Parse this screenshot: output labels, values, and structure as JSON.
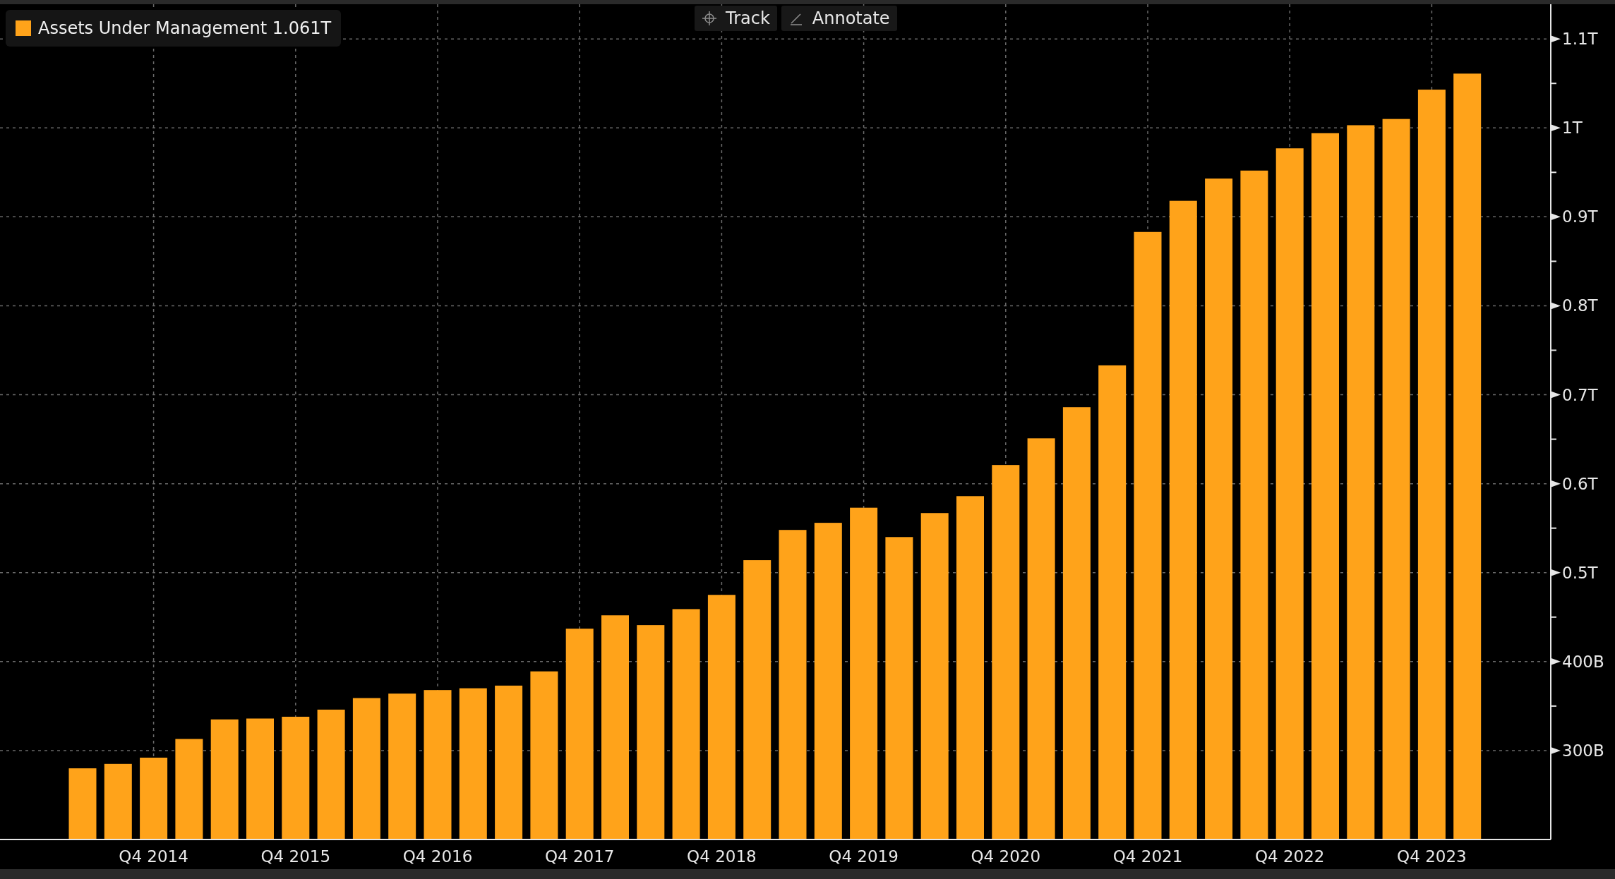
{
  "toolbar": [
    {
      "label": "Track",
      "kind": "track"
    },
    {
      "label": "Annotate",
      "kind": "annotate"
    }
  ],
  "legend": {
    "value": "1.061T"
  },
  "chart_data": {
    "type": "bar",
    "grid": true,
    "categories": [
      null,
      null,
      "Q4 2014",
      null,
      null,
      null,
      "Q4 2015",
      null,
      null,
      null,
      "Q4 2016",
      null,
      null,
      null,
      "Q4 2017",
      null,
      null,
      null,
      "Q4 2018",
      null,
      null,
      null,
      "Q4 2019",
      null,
      null,
      null,
      "Q4 2020",
      null,
      null,
      null,
      "Q4 2021",
      null,
      null,
      null,
      "Q4 2022",
      null,
      null,
      null,
      "Q4 2023",
      null
    ],
    "series": [
      {
        "name": "Assets Under Management",
        "color": "#ffa31a",
        "values": [
          280000000000,
          285000000000,
          292000000000,
          313000000000,
          335000000000,
          336000000000,
          338000000000,
          346000000000,
          359000000000,
          364000000000,
          368000000000,
          370000000000,
          373000000000,
          389000000000,
          437000000000,
          452000000000,
          441000000000,
          459000000000,
          475000000000,
          514000000000,
          548000000000,
          556000000000,
          573000000000,
          540000000000,
          567000000000,
          586000000000,
          621000000000,
          651000000000,
          686000000000,
          733000000000,
          883000000000,
          918000000000,
          943000000000,
          952000000000,
          977000000000,
          994000000000,
          1003000000000,
          1010000000000,
          1043000000000,
          1061000000000
        ]
      }
    ],
    "ylim": [
      200000000000,
      1139000000000
    ],
    "yticks": [
      {
        "value": 300000000000,
        "label": "300B"
      },
      {
        "value": 400000000000,
        "label": "400B"
      },
      {
        "value": 500000000000,
        "label": "0.5T"
      },
      {
        "value": 600000000000,
        "label": "0.6T"
      },
      {
        "value": 700000000000,
        "label": "0.7T"
      },
      {
        "value": 800000000000,
        "label": "0.8T"
      },
      {
        "value": 900000000000,
        "label": "0.9T"
      },
      {
        "value": 1000000000000,
        "label": "1T"
      },
      {
        "value": 1100000000000,
        "label": "1.1T"
      }
    ]
  }
}
